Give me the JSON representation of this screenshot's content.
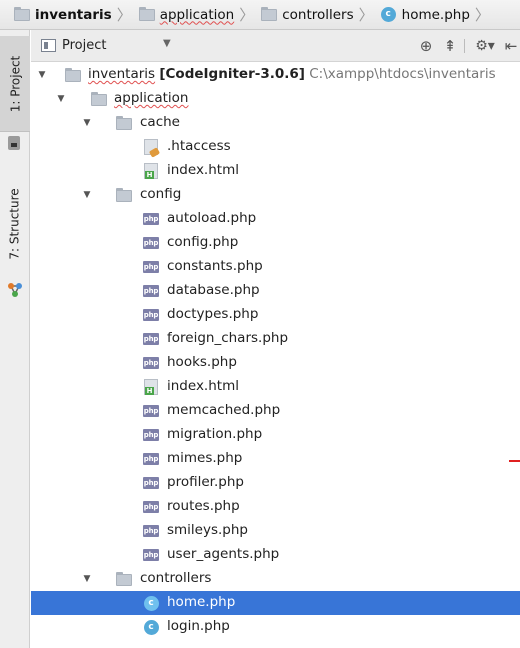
{
  "breadcrumb": {
    "items": [
      {
        "label": "inventaris",
        "bold": true,
        "icon": "folder-icon"
      },
      {
        "label": "application",
        "bold": false,
        "icon": "folder-icon"
      },
      {
        "label": "controllers",
        "bold": false,
        "icon": "folder-icon"
      },
      {
        "label": "home.php",
        "bold": false,
        "icon": "php-class-icon"
      }
    ]
  },
  "side_tabs": {
    "project": "1: Project",
    "structure": "7: Structure"
  },
  "panel": {
    "view_label": "Project",
    "icons": [
      "project-view-icon",
      "locate-target-icon",
      "collapse-all-icon",
      "gear-icon",
      "hide-panel-icon"
    ]
  },
  "tree": {
    "root": {
      "name": "inventaris",
      "project": "[CodeIgniter-3.0.6]",
      "path": "C:\\xampp\\htdocs\\inventaris"
    },
    "application": "application",
    "cache": {
      "name": "cache",
      "files": [
        ".htaccess",
        "index.html"
      ]
    },
    "config": {
      "name": "config",
      "files": [
        "autoload.php",
        "config.php",
        "constants.php",
        "database.php",
        "doctypes.php",
        "foreign_chars.php",
        "hooks.php",
        "index.html",
        "memcached.php",
        "migration.php",
        "mimes.php",
        "profiler.php",
        "routes.php",
        "smileys.php",
        "user_agents.php"
      ]
    },
    "controllers": {
      "name": "controllers",
      "files": [
        "home.php",
        "login.php"
      ],
      "selected": "home.php"
    }
  },
  "colors": {
    "selection": "#3875d7",
    "php_icon": "#7d7fa8",
    "class_icon": "#53a9d8",
    "folder_icon": "#c3cad3"
  }
}
